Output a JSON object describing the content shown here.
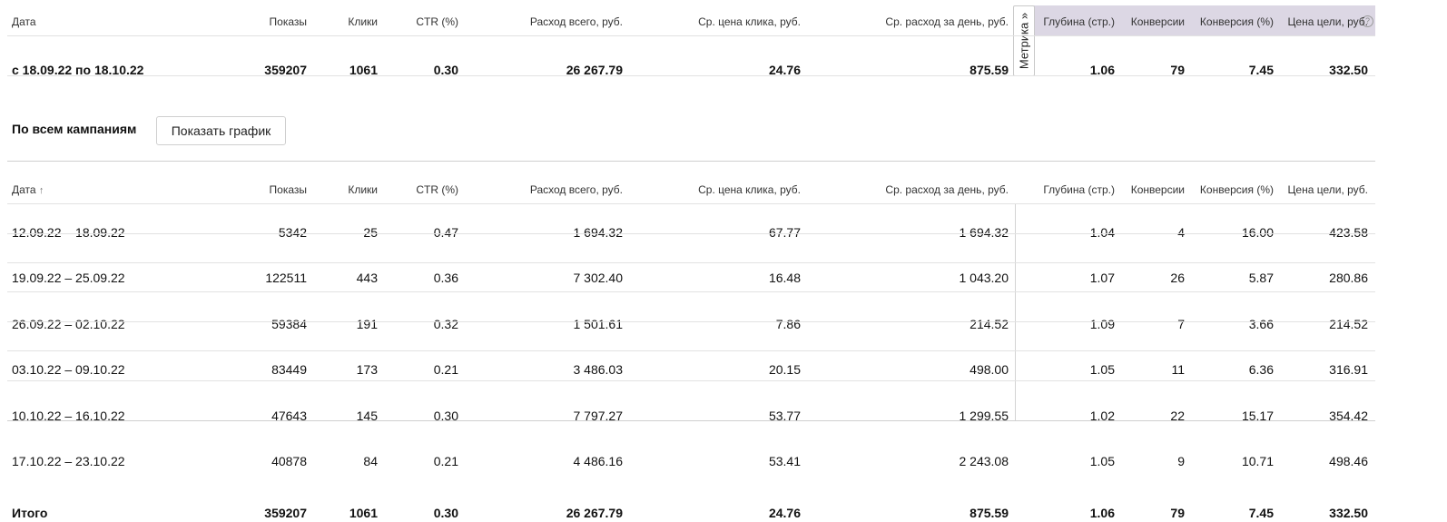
{
  "columns": [
    "Дата",
    "Показы",
    "Клики",
    "CTR (%)",
    "Расход всего, руб.",
    "Ср. цена клика, руб.",
    "Ср. расход за день, руб.",
    "Глубина (стр.)",
    "Конверсии",
    "Конверсия (%)",
    "Цена цели, руб."
  ],
  "metrika_button_label": "Метрика »",
  "summary_row": [
    "с 18.09.22 по 18.10.22",
    "359207",
    "1061",
    "0.30",
    "26 267.79",
    "24.76",
    "875.59",
    "1.06",
    "79",
    "7.45",
    "332.50"
  ],
  "section": {
    "title": "По всем кампаниям",
    "show_chart_label": "Показать график"
  },
  "detail": {
    "sort_indicator": "↑",
    "rows": [
      [
        "12.09.22 – 18.09.22",
        "5342",
        "25",
        "0.47",
        "1 694.32",
        "67.77",
        "1 694.32",
        "1.04",
        "4",
        "16.00",
        "423.58"
      ],
      [
        "19.09.22 – 25.09.22",
        "122511",
        "443",
        "0.36",
        "7 302.40",
        "16.48",
        "1 043.20",
        "1.07",
        "26",
        "5.87",
        "280.86"
      ],
      [
        "26.09.22 – 02.10.22",
        "59384",
        "191",
        "0.32",
        "1 501.61",
        "7.86",
        "214.52",
        "1.09",
        "7",
        "3.66",
        "214.52"
      ],
      [
        "03.10.22 – 09.10.22",
        "83449",
        "173",
        "0.21",
        "3 486.03",
        "20.15",
        "498.00",
        "1.05",
        "11",
        "6.36",
        "316.91"
      ],
      [
        "10.10.22 – 16.10.22",
        "47643",
        "145",
        "0.30",
        "7 797.27",
        "53.77",
        "1 299.55",
        "1.02",
        "22",
        "15.17",
        "354.42"
      ],
      [
        "17.10.22 – 23.10.22",
        "40878",
        "84",
        "0.21",
        "4 486.16",
        "53.41",
        "2 243.08",
        "1.05",
        "9",
        "10.71",
        "498.46"
      ]
    ],
    "total_row": [
      "Итого",
      "359207",
      "1061",
      "0.30",
      "26 267.79",
      "24.76",
      "875.59",
      "1.06",
      "79",
      "7.45",
      "332.50"
    ]
  }
}
